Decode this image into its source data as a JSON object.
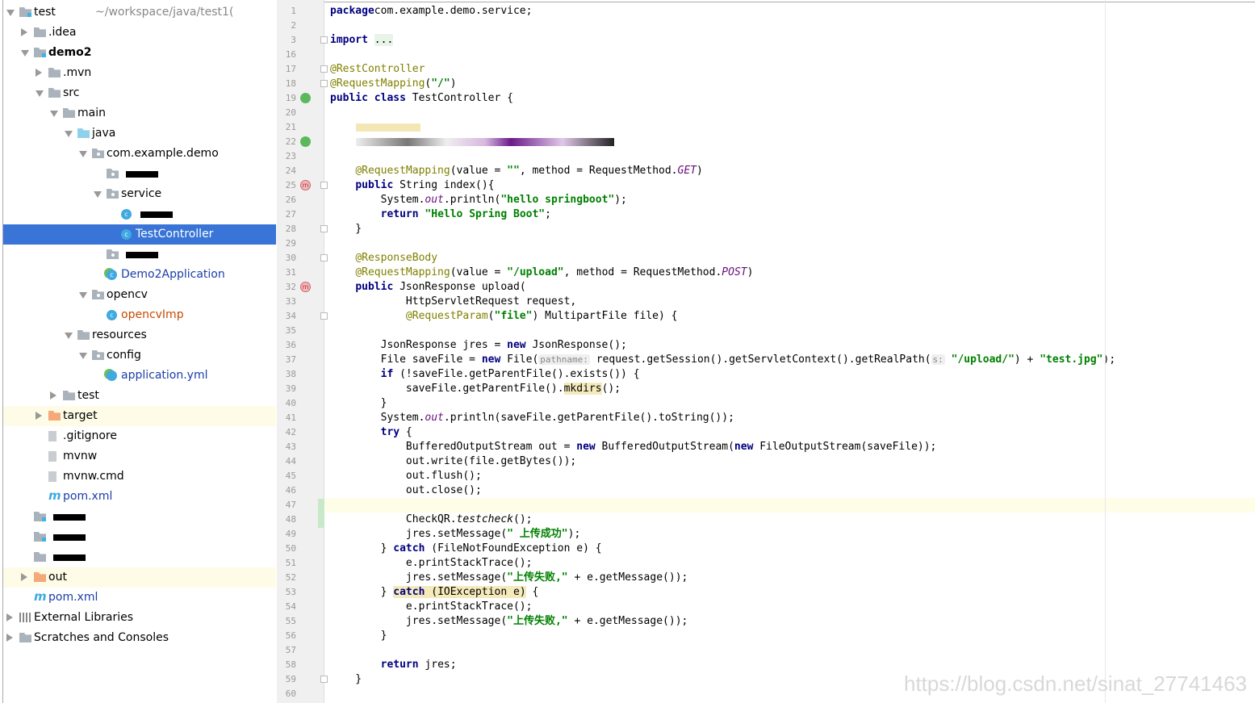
{
  "project_tree": {
    "root_path": "~/workspace/java/test1(",
    "items": [
      {
        "label": "test",
        "level": 0,
        "state": "down",
        "icon": "module-folder-icon",
        "has_path": true
      },
      {
        "label": ".idea",
        "level": 1,
        "state": "right",
        "icon": "folder-icon"
      },
      {
        "label": "demo2",
        "level": 1,
        "state": "down",
        "icon": "module-folder-icon",
        "bold": true
      },
      {
        "label": ".mvn",
        "level": 2,
        "state": "right",
        "icon": "folder-icon"
      },
      {
        "label": "src",
        "level": 2,
        "state": "down",
        "icon": "folder-icon"
      },
      {
        "label": "main",
        "level": 3,
        "state": "down",
        "icon": "folder-icon"
      },
      {
        "label": "java",
        "level": 4,
        "state": "down",
        "icon": "source-folder-icon"
      },
      {
        "label": "com.example.demo",
        "level": 5,
        "state": "down",
        "icon": "package-icon"
      },
      {
        "label": "",
        "level": 6,
        "state": "none",
        "icon": "package-icon",
        "redacted": true
      },
      {
        "label": "service",
        "level": 6,
        "state": "down",
        "icon": "package-icon"
      },
      {
        "label": "",
        "level": 7,
        "state": "none",
        "icon": "class-icon",
        "redacted": true
      },
      {
        "label": "TestController",
        "level": 7,
        "state": "none",
        "icon": "class-icon",
        "selected": true
      },
      {
        "label": "",
        "level": 6,
        "state": "none",
        "icon": "package-icon",
        "redacted": true
      },
      {
        "label": "Demo2Application",
        "level": 6,
        "state": "none",
        "icon": "spring-boot-class-icon",
        "color": "blue"
      },
      {
        "label": "opencv",
        "level": 5,
        "state": "down",
        "icon": "package-icon"
      },
      {
        "label": "opencvImp",
        "level": 6,
        "state": "none",
        "icon": "class-icon",
        "color": "orange"
      },
      {
        "label": "resources",
        "level": 4,
        "state": "down",
        "icon": "resources-folder-icon"
      },
      {
        "label": "config",
        "level": 5,
        "state": "down",
        "icon": "package-icon"
      },
      {
        "label": "application.yml",
        "level": 6,
        "state": "none",
        "icon": "spring-yml-icon",
        "color": "blue"
      },
      {
        "label": "test",
        "level": 3,
        "state": "right",
        "icon": "folder-icon"
      },
      {
        "label": "target",
        "level": 2,
        "state": "right",
        "icon": "excluded-folder-icon",
        "highlight": true
      },
      {
        "label": ".gitignore",
        "level": 2,
        "state": "none",
        "icon": "file-icon"
      },
      {
        "label": "mvnw",
        "level": 2,
        "state": "none",
        "icon": "file-icon"
      },
      {
        "label": "mvnw.cmd",
        "level": 2,
        "state": "none",
        "icon": "file-icon"
      },
      {
        "label": "pom.xml",
        "level": 2,
        "state": "none",
        "icon": "maven-icon",
        "color": "blue"
      },
      {
        "label": "",
        "level": 1,
        "state": "none",
        "icon": "module-folder-icon",
        "redacted": true
      },
      {
        "label": "",
        "level": 1,
        "state": "none",
        "icon": "module-folder-icon",
        "redacted": true
      },
      {
        "label": "",
        "level": 1,
        "state": "none",
        "icon": "folder-icon",
        "redacted": true
      },
      {
        "label": "out",
        "level": 1,
        "state": "right",
        "icon": "excluded-folder-icon",
        "highlight": true
      },
      {
        "label": "pom.xml",
        "level": 1,
        "state": "none",
        "icon": "maven-icon",
        "color": "blue"
      },
      {
        "label": "External Libraries",
        "level": 0,
        "state": "right",
        "icon": "libraries-icon"
      },
      {
        "label": "Scratches and Consoles",
        "level": 0,
        "state": "right",
        "icon": "scratches-icon"
      }
    ]
  },
  "editor": {
    "lines": [
      {
        "n": "1",
        "t": [
          [
            "kw",
            "package"
          ],
          [
            "",
            "com.example.demo.service;"
          ]
        ]
      },
      {
        "n": "2",
        "t": []
      },
      {
        "n": "3",
        "t": [
          [
            "kw",
            "import"
          ],
          [
            "",
            " "
          ],
          [
            "fb",
            "..."
          ]
        ],
        "fold": true
      },
      {
        "n": "16",
        "t": []
      },
      {
        "n": "17",
        "t": [
          [
            "ann",
            "@RestController"
          ]
        ],
        "fold": true
      },
      {
        "n": "18",
        "t": [
          [
            "ann",
            "@RequestMapping"
          ],
          [
            "",
            "("
          ],
          [
            "str",
            "\"/\""
          ],
          [
            "",
            ")"
          ]
        ],
        "fold": true
      },
      {
        "n": "19",
        "t": [
          [
            "kw",
            "public class"
          ],
          [
            "",
            " TestController {"
          ]
        ],
        "gicon": "c"
      },
      {
        "n": "20",
        "t": []
      },
      {
        "n": "21",
        "t": [],
        "redacted": "a"
      },
      {
        "n": "22",
        "t": [],
        "redacted": "b",
        "gicon": "c"
      },
      {
        "n": "23",
        "t": []
      },
      {
        "n": "24",
        "t": [
          [
            "",
            "    "
          ],
          [
            "ann",
            "@RequestMapping"
          ],
          [
            "",
            "(value = "
          ],
          [
            "str",
            "\"\""
          ],
          [
            "",
            ", method = RequestMethod."
          ],
          [
            "fld",
            "GET"
          ],
          [
            "",
            ")"
          ]
        ]
      },
      {
        "n": "25",
        "t": [
          [
            "",
            "    "
          ],
          [
            "kw",
            "public"
          ],
          [
            "",
            " String index(){"
          ]
        ],
        "gicon": "m",
        "fold": true
      },
      {
        "n": "26",
        "t": [
          [
            "",
            "        System."
          ],
          [
            "fld",
            "out"
          ],
          [
            "",
            ".println("
          ],
          [
            "str",
            "\"hello springboot\""
          ],
          [
            "",
            ");"
          ]
        ]
      },
      {
        "n": "27",
        "t": [
          [
            "",
            "        "
          ],
          [
            "kw",
            "return"
          ],
          [
            "",
            " "
          ],
          [
            "str",
            "\"Hello Spring Boot\""
          ],
          [
            "",
            ";"
          ]
        ]
      },
      {
        "n": "28",
        "t": [
          [
            "",
            "    }"
          ]
        ],
        "fold": true
      },
      {
        "n": "29",
        "t": []
      },
      {
        "n": "30",
        "t": [
          [
            "",
            "    "
          ],
          [
            "ann",
            "@ResponseBody"
          ]
        ],
        "fold": true
      },
      {
        "n": "31",
        "t": [
          [
            "",
            "    "
          ],
          [
            "ann",
            "@RequestMapping"
          ],
          [
            "",
            "(value = "
          ],
          [
            "str",
            "\"/upload\""
          ],
          [
            "",
            ", method = RequestMethod."
          ],
          [
            "fld",
            "POST"
          ],
          [
            "",
            ")"
          ]
        ]
      },
      {
        "n": "32",
        "t": [
          [
            "",
            "    "
          ],
          [
            "kw",
            "public"
          ],
          [
            "",
            " JsonResponse upload("
          ]
        ],
        "gicon": "m"
      },
      {
        "n": "33",
        "t": [
          [
            "",
            "            HttpServletRequest request,"
          ]
        ]
      },
      {
        "n": "34",
        "t": [
          [
            "",
            "            "
          ],
          [
            "ann",
            "@RequestParam"
          ],
          [
            "",
            "("
          ],
          [
            "str",
            "\"file\""
          ],
          [
            "",
            ") MultipartFile file) {"
          ]
        ],
        "fold": true
      },
      {
        "n": "35",
        "t": []
      },
      {
        "n": "36",
        "t": [
          [
            "",
            "        JsonResponse jres = "
          ],
          [
            "kw",
            "new"
          ],
          [
            "",
            " JsonResponse();"
          ]
        ]
      },
      {
        "n": "37",
        "t": [
          [
            "",
            "        File saveFile = "
          ],
          [
            "kw",
            "new"
          ],
          [
            "",
            " File("
          ],
          [
            "hint",
            "pathname:"
          ],
          [
            "",
            " request.getSession().getServletContext().getRealPath("
          ],
          [
            "hint",
            "s:"
          ],
          [
            "",
            " "
          ],
          [
            "str",
            "\"/upload/\""
          ],
          [
            "",
            ") + "
          ],
          [
            "str",
            "\"test.jpg\""
          ],
          [
            "",
            ");"
          ]
        ]
      },
      {
        "n": "38",
        "t": [
          [
            "",
            "        "
          ],
          [
            "kw",
            "if"
          ],
          [
            "",
            " (!saveFile.getParentFile().exists()) {"
          ]
        ]
      },
      {
        "n": "39",
        "t": [
          [
            "",
            "            saveFile.getParentFile()."
          ],
          [
            "mark",
            "mkdirs"
          ],
          [
            "",
            "();"
          ]
        ]
      },
      {
        "n": "40",
        "t": [
          [
            "",
            "        }"
          ]
        ]
      },
      {
        "n": "41",
        "t": [
          [
            "",
            "        System."
          ],
          [
            "fld",
            "out"
          ],
          [
            "",
            ".println(saveFile.getParentFile().toString());"
          ]
        ]
      },
      {
        "n": "42",
        "t": [
          [
            "",
            "        "
          ],
          [
            "kw",
            "try"
          ],
          [
            "",
            " {"
          ]
        ]
      },
      {
        "n": "43",
        "t": [
          [
            "",
            "            BufferedOutputStream out = "
          ],
          [
            "kw",
            "new"
          ],
          [
            "",
            " BufferedOutputStream("
          ],
          [
            "kw",
            "new"
          ],
          [
            "",
            " FileOutputStream(saveFile));"
          ]
        ]
      },
      {
        "n": "44",
        "t": [
          [
            "",
            "            out.write(file.getBytes());"
          ]
        ]
      },
      {
        "n": "45",
        "t": [
          [
            "",
            "            out.flush();"
          ]
        ]
      },
      {
        "n": "46",
        "t": [
          [
            "",
            "            out.close();"
          ]
        ]
      },
      {
        "n": "47",
        "t": [],
        "current": true
      },
      {
        "n": "48",
        "t": [
          [
            "",
            "            CheckQR."
          ],
          [
            "it",
            "testcheck"
          ],
          [
            "",
            "();"
          ]
        ]
      },
      {
        "n": "49",
        "t": [
          [
            "",
            "            jres.setMessage("
          ],
          [
            "str",
            "\" 上传成功\""
          ],
          [
            "",
            ");"
          ]
        ]
      },
      {
        "n": "50",
        "t": [
          [
            "",
            "        } "
          ],
          [
            "kw",
            "catch"
          ],
          [
            "",
            " (FileNotFoundException e) {"
          ]
        ]
      },
      {
        "n": "51",
        "t": [
          [
            "",
            "            e.printStackTrace();"
          ]
        ]
      },
      {
        "n": "52",
        "t": [
          [
            "",
            "            jres.setMessage("
          ],
          [
            "str",
            "\"上传失败,\""
          ],
          [
            "",
            " + e.getMessage());"
          ]
        ]
      },
      {
        "n": "53",
        "t": [
          [
            "",
            "        } "
          ],
          [
            "kw mark",
            "catch"
          ],
          [
            "mark",
            " (IOException e)"
          ],
          [
            "",
            " {"
          ]
        ]
      },
      {
        "n": "54",
        "t": [
          [
            "",
            "            e.printStackTrace();"
          ]
        ]
      },
      {
        "n": "55",
        "t": [
          [
            "",
            "            jres.setMessage("
          ],
          [
            "str",
            "\"上传失败,\""
          ],
          [
            "",
            " + e.getMessage());"
          ]
        ]
      },
      {
        "n": "56",
        "t": [
          [
            "",
            "        }"
          ]
        ]
      },
      {
        "n": "57",
        "t": []
      },
      {
        "n": "58",
        "t": [
          [
            "",
            "        "
          ],
          [
            "kw",
            "return"
          ],
          [
            "",
            " jres;"
          ]
        ]
      },
      {
        "n": "59",
        "t": [
          [
            "",
            "    }"
          ]
        ],
        "fold": true
      },
      {
        "n": "60",
        "t": []
      }
    ]
  },
  "watermark": "https://blog.csdn.net/sinat_27741463"
}
